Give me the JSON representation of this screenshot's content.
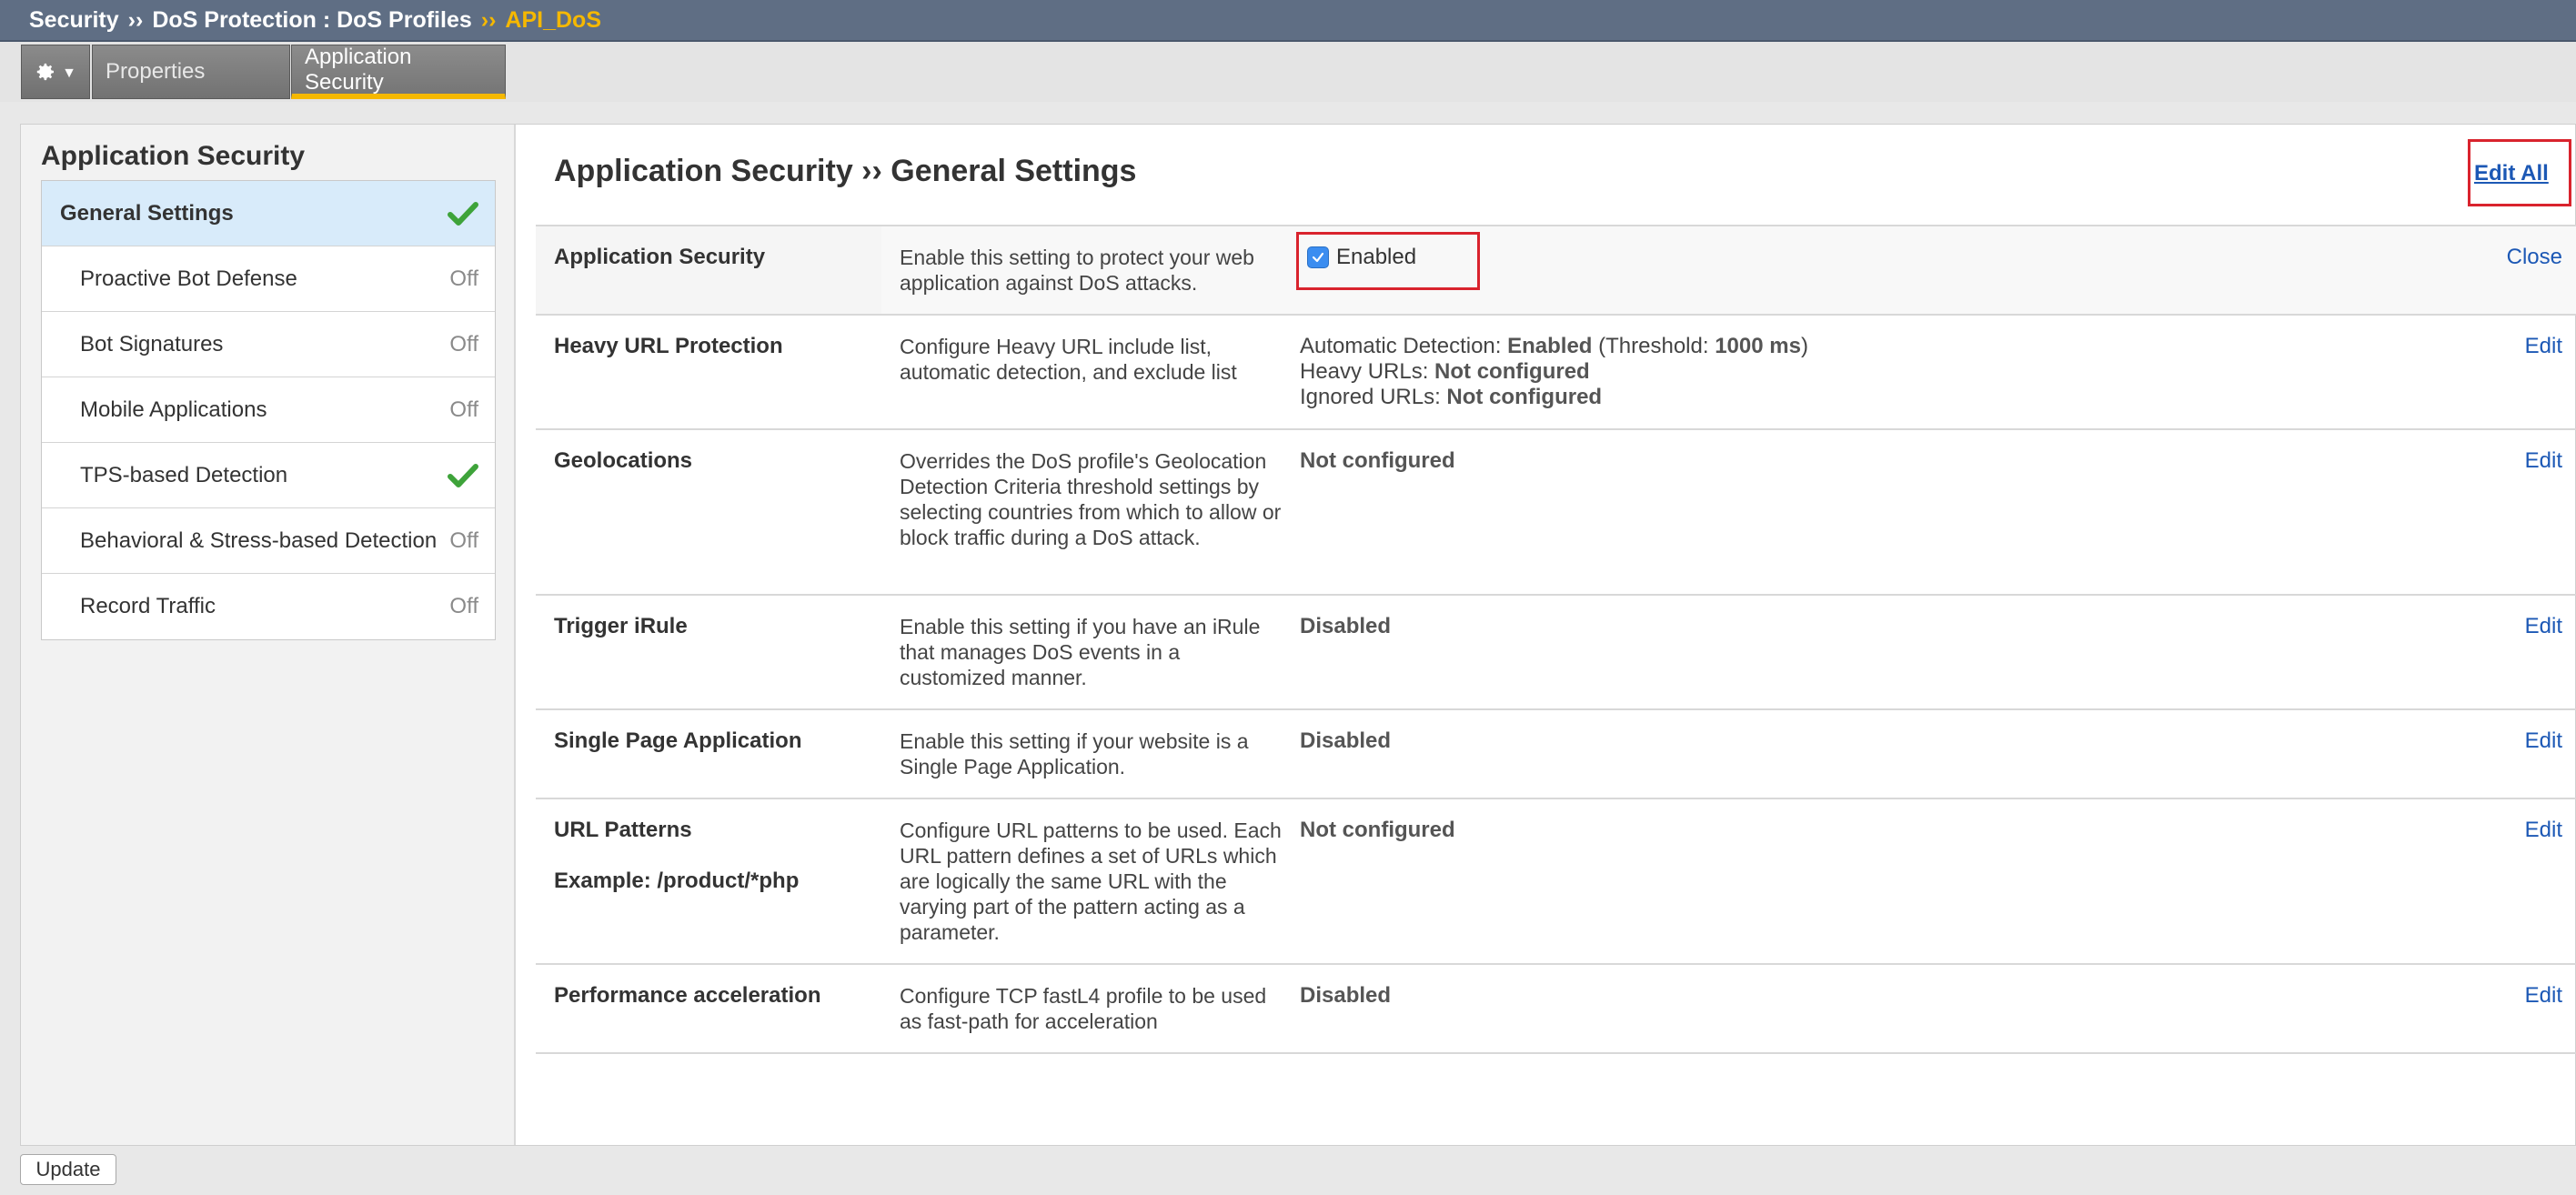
{
  "breadcrumb": {
    "items": [
      "Security",
      "DoS Protection : DoS Profiles"
    ],
    "separator": "››",
    "current": "API_DoS"
  },
  "tabs": {
    "gear_icon": "gear-icon",
    "items": [
      "Properties",
      "Application Security"
    ],
    "active": "Application Security"
  },
  "sidebar": {
    "title": "Application Security",
    "items": [
      {
        "label": "General Settings",
        "state": "check"
      },
      {
        "label": "Proactive Bot Defense",
        "state": "Off"
      },
      {
        "label": "Bot Signatures",
        "state": "Off"
      },
      {
        "label": "Mobile Applications",
        "state": "Off"
      },
      {
        "label": "TPS-based Detection",
        "state": "check"
      },
      {
        "label": "Behavioral & Stress-based Detection",
        "state": "Off"
      },
      {
        "label": "Record Traffic",
        "state": "Off"
      }
    ]
  },
  "main": {
    "title": "Application Security ›› General Settings",
    "edit_all": "Edit All",
    "rows": [
      {
        "name": "Application Security",
        "desc": "Enable this setting to protect your web application against DoS attacks.",
        "checkbox_label": "Enabled",
        "checked": true,
        "action": "Close"
      },
      {
        "name": "Heavy URL Protection",
        "desc": "Configure Heavy URL include list, automatic detection, and exclude list",
        "value": {
          "auto_prefix": "Automatic Detection: ",
          "auto_value": "Enabled",
          "threshold_prefix": " (Threshold: ",
          "threshold_value": "1000 ms",
          "threshold_suffix": ")",
          "heavy_prefix": "Heavy URLs: ",
          "heavy_value": "Not configured",
          "ignored_prefix": "Ignored URLs: ",
          "ignored_value": "Not configured"
        },
        "action": "Edit"
      },
      {
        "name": "Geolocations",
        "desc": "Overrides the DoS profile's Geolocation Detection Criteria threshold settings by selecting countries from which to allow or block traffic during a DoS attack.",
        "value": "Not configured",
        "action": "Edit"
      },
      {
        "name": "Trigger iRule",
        "desc": "Enable this setting if you have an iRule that manages DoS events in a customized manner.",
        "value": "Disabled",
        "action": "Edit"
      },
      {
        "name": "Single Page Application",
        "desc": "Enable this setting if your website is a Single Page Application.",
        "value": "Disabled",
        "action": "Edit"
      },
      {
        "name": "URL Patterns",
        "example": "Example: /product/*php",
        "desc": "Configure URL patterns to be used. Each URL pattern defines a set of URLs which are logically the same URL with the varying part of the pattern acting as a parameter.",
        "value": "Not configured",
        "action": "Edit"
      },
      {
        "name": "Performance acceleration",
        "desc": "Configure TCP fastL4 profile to be used as fast-path for acceleration",
        "value": "Disabled",
        "action": "Edit"
      }
    ]
  },
  "footer": {
    "update_label": "Update"
  },
  "colors": {
    "accent": "#f5b800",
    "link": "#1c58b5",
    "highlight_box": "#d9232d",
    "check": "#3ea33a"
  }
}
